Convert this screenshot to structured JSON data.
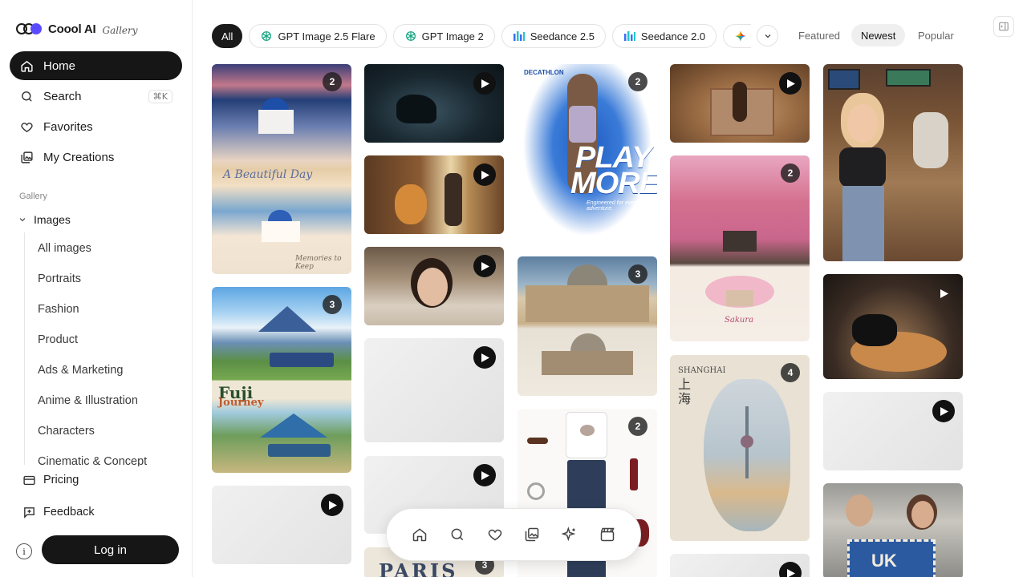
{
  "app": {
    "name": "Coool AI",
    "section": "Gallery"
  },
  "nav": {
    "home": "Home",
    "search": "Search",
    "search_shortcut": "⌘K",
    "favorites": "Favorites",
    "my_creations": "My Creations"
  },
  "gallery": {
    "label": "Gallery",
    "group": "Images",
    "items": [
      "All images",
      "Portraits",
      "Fashion",
      "Product",
      "Ads & Marketing",
      "Anime & Illustration",
      "Characters",
      "Cinematic & Concept"
    ]
  },
  "bottom": {
    "pricing": "Pricing",
    "feedback": "Feedback",
    "info": "i",
    "login": "Log in"
  },
  "filters": {
    "chips": [
      {
        "label": "All",
        "icon": "none",
        "active": true
      },
      {
        "label": "GPT Image 2.5 Flare",
        "icon": "openai-icon"
      },
      {
        "label": "GPT Image 2",
        "icon": "openai-icon"
      },
      {
        "label": "Seedance 2.5",
        "icon": "bars-icon"
      },
      {
        "label": "Seedance 2.0",
        "icon": "bars-icon"
      },
      {
        "label": "",
        "icon": "gemini-star-icon"
      }
    ],
    "sort": [
      "Featured",
      "Newest",
      "Popular"
    ],
    "sort_active": "Newest"
  },
  "tiles": {
    "santorini": {
      "badge": "2",
      "script": "A Beautiful Day",
      "caption": "Memories to Keep"
    },
    "fuji": {
      "badge": "3",
      "title": "Fuji",
      "title2": "Journey"
    },
    "sport": {
      "badge": "2",
      "brand": "DECATHLON",
      "headline": "PLAY",
      "headline2": "MORE.",
      "tagline": "Engineered for every adventure."
    },
    "vatican": {
      "badge": "3"
    },
    "outfit": {
      "badge": "2"
    },
    "sakura": {
      "badge": "2",
      "caption": "Sakura"
    },
    "shanghai": {
      "badge": "4",
      "title": "SHANGHAI",
      "cn": "上海"
    },
    "paris": {
      "badge": "3",
      "title": "PARIS"
    },
    "uk": {
      "title": "UK"
    }
  },
  "colors": {
    "accent": "#161616",
    "brand": "#5b4bff"
  }
}
